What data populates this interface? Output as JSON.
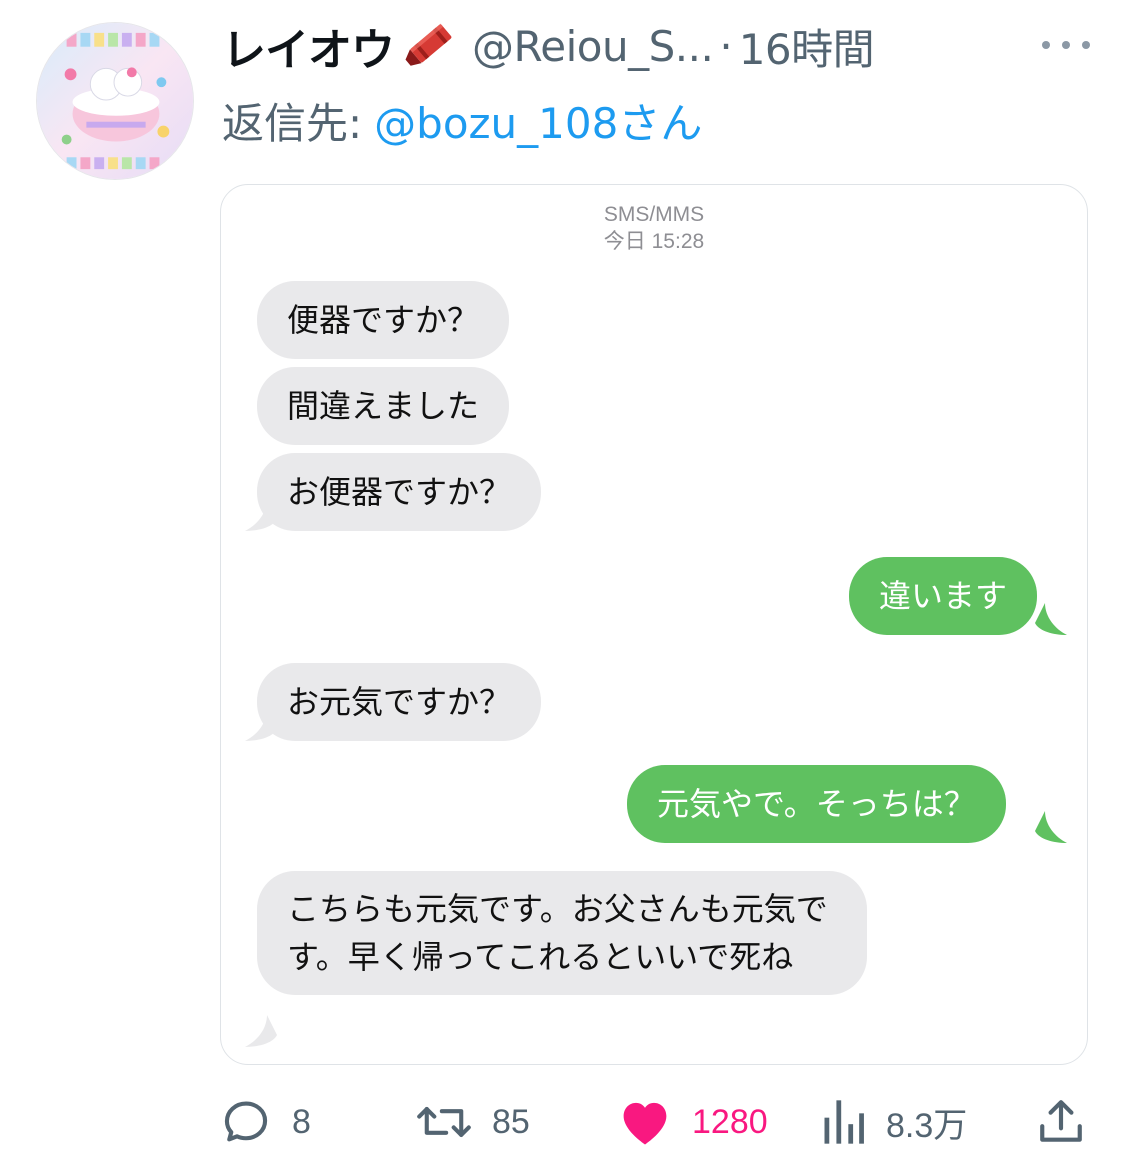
{
  "author": {
    "display_name": "レイオウ",
    "handle": "@Reiou_S...",
    "time": "16時間"
  },
  "reply": {
    "label": "返信先:",
    "target": "@bozu_108さん"
  },
  "conversation": {
    "service": "SMS/MMS",
    "timestamp": "今日 15:28",
    "messages": [
      {
        "side": "incoming",
        "text": "便器ですか？"
      },
      {
        "side": "incoming",
        "text": "間違えました"
      },
      {
        "side": "incoming",
        "text": "お便器ですか？"
      },
      {
        "side": "outgoing",
        "text": "違います"
      },
      {
        "side": "incoming",
        "text": "お元気ですか？"
      },
      {
        "side": "outgoing",
        "text": "元気やで。そっちは？"
      },
      {
        "side": "incoming",
        "text": "こちらも元気です。お父さんも元気です。早く帰ってこれるといいで死ね"
      }
    ]
  },
  "actions": {
    "replies": "8",
    "retweets": "85",
    "likes": "1280",
    "views": "8.3万"
  },
  "colors": {
    "incoming_bubble": "#e9e9eb",
    "outgoing_bubble": "#5fc160",
    "like": "#f91880",
    "link": "#1d9bf0",
    "secondary_text": "#536471"
  },
  "icons": {
    "more": "more-icon",
    "reply": "reply-icon",
    "retweet": "retweet-icon",
    "like": "heart-icon",
    "views": "views-icon",
    "share": "share-icon",
    "name_emoji": "crayon-icon"
  }
}
